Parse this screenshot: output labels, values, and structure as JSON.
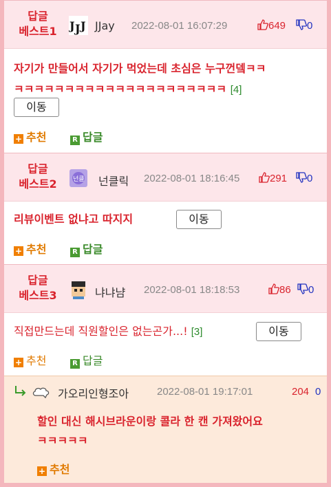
{
  "posts": [
    {
      "best_label": [
        "답글",
        "베스트1"
      ],
      "nickname": "JJay",
      "avatar": "jjj-logo-icon",
      "date": "2022-08-01 16:07:29",
      "up": "649",
      "down": "0",
      "content_line1": "자기가 만들어서 자기가 먹었는데 초심은 누구껀뎈ㅋㅋ",
      "content_line2": "ㅋㅋㅋㅋㅋㅋㅋㅋㅋㅋㅋㅋㅋㅋㅋㅋㅋㅋㅋㅋㅋ",
      "comment_count": "[4]",
      "move_label": "이동",
      "recommend_label": "추천",
      "reply_label": "답글"
    },
    {
      "best_label": [
        "답글",
        "베스트2"
      ],
      "nickname": "넌클릭",
      "avatar": "purple-badge-icon",
      "date": "2022-08-01 18:16:45",
      "up": "291",
      "down": "0",
      "content_line1": "리뷰이벤트 없냐고 따지지",
      "move_label": "이동",
      "recommend_label": "추천",
      "reply_label": "답글"
    },
    {
      "best_label": [
        "답글",
        "베스트3"
      ],
      "nickname": "냐냐냠",
      "avatar": "pixel-face-icon",
      "date": "2022-08-01 18:18:53",
      "up": "86",
      "down": "0",
      "content_line1": "직접만드는데 직원할인은 없는곤가...!",
      "comment_count": "[3]",
      "move_label": "이동",
      "recommend_label": "추천",
      "reply_label": "답글"
    }
  ],
  "reply": {
    "nickname": "가오리인형조아",
    "avatar": "cloud-icon",
    "date": "2022-08-01 19:17:01",
    "up": "204",
    "down": "0",
    "content_line1": "할인 대신 해시브라운이랑 콜라 한 캔 가져왔어요",
    "content_line2": "ㅋㅋㅋㅋㅋ",
    "recommend_label": "추천"
  },
  "colors": {
    "best_red": "#d9232d",
    "header_pink": "#fde6ea",
    "reply_bg": "#fdeadb",
    "down_blue": "#2233c0",
    "comment_green": "#2c8a2c"
  }
}
